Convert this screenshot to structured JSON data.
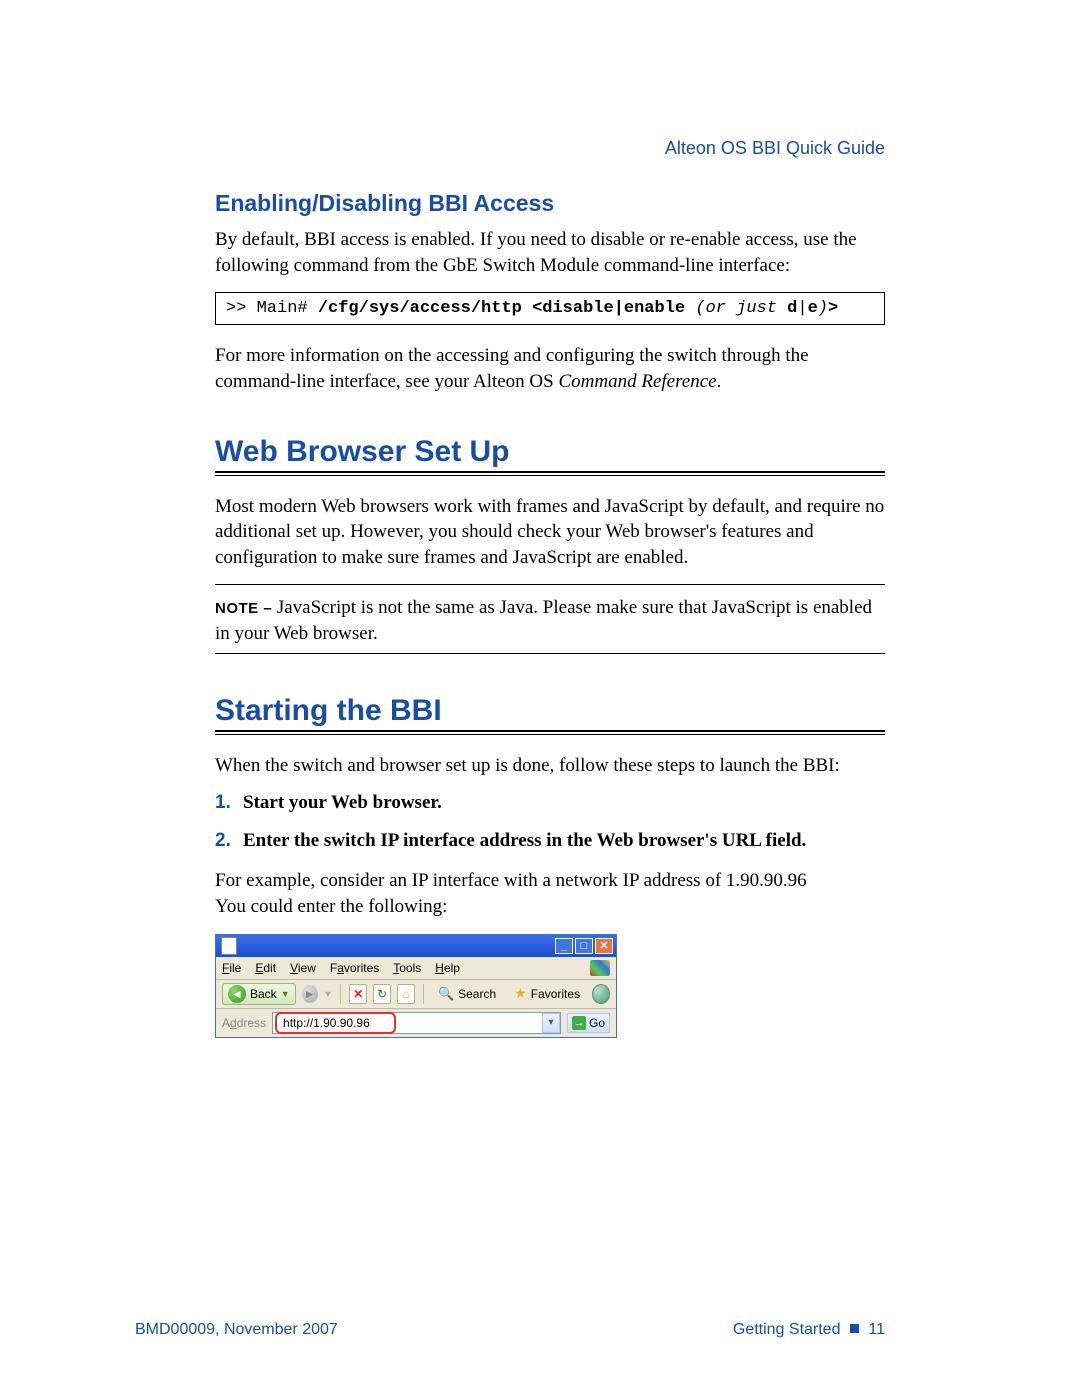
{
  "header_right": "Alteon OS  BBI Quick Guide",
  "h3_enable": "Enabling/Disabling BBI Access",
  "p_enable": "By default, BBI access is enabled. If you need to disable or re-enable access, use the following command from the GbE Switch Module command-line interface:",
  "cmd": {
    "prompt": ">> Main# ",
    "path": "/cfg/sys/access/http ",
    "angle_open": "<",
    "opt1": "disable",
    "pipe": "|",
    "opt2": "enable",
    "note_open": " (",
    "note_ital": "or just ",
    "note_bold1": "d",
    "note_pipe": "|",
    "note_bold2": "e",
    "note_close": ")",
    "angle_close": ">"
  },
  "p_moreinfo_a": "For more information on the accessing and configuring the switch through the command-line interface, see your Alteon OS ",
  "p_moreinfo_ref": "Command Reference",
  "p_moreinfo_b": ".",
  "h1_web": "Web Browser Set Up",
  "p_web": "Most modern Web browsers work with frames and JavaScript by default, and require no additional set up. However, you should check your Web browser's features and configuration to make sure frames and JavaScript are enabled.",
  "note_lbl": "NOTE – ",
  "note_txt": "JavaScript is not the same as Java. Please make sure that JavaScript is enabled in your Web browser.",
  "h1_start": "Starting the BBI",
  "p_start": "When the switch and browser set up is done, follow these steps to launch the BBI:",
  "steps": {
    "s1_num": "1.",
    "s1": "Start your Web browser.",
    "s2_num": "2.",
    "s2": "Enter the switch IP interface address in the Web browser's URL field."
  },
  "p_example_a": "For example, consider an IP interface with a network IP address of 1.90.90.96",
  "p_example_b": "You could enter the following:",
  "browser": {
    "menu_file": "File",
    "menu_edit": "Edit",
    "menu_view": "View",
    "menu_fav": "Favorites",
    "menu_tools": "Tools",
    "menu_help": "Help",
    "back": "Back",
    "search": "Search",
    "favorites": "Favorites",
    "address_lbl": "Address",
    "url": "http://1.90.90.96",
    "go": "Go"
  },
  "footer": {
    "left": "BMD00009, November 2007",
    "right_a": "Getting Started",
    "right_b": "11"
  }
}
